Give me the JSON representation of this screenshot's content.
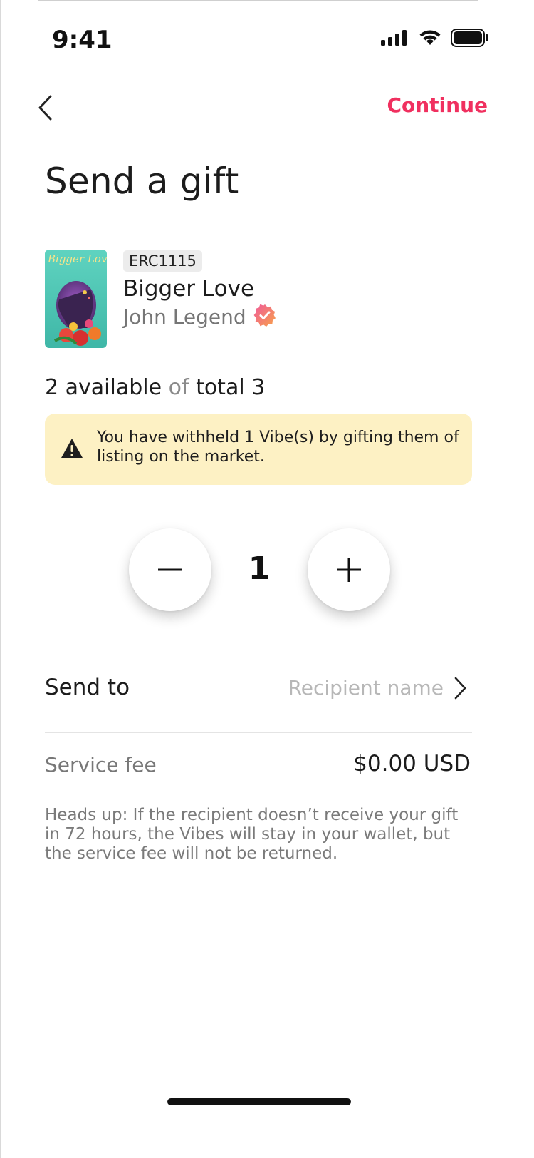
{
  "status_bar": {
    "time": "9:41",
    "icons": [
      "signal-icon",
      "wifi-icon",
      "battery-icon"
    ]
  },
  "nav": {
    "back_icon": "chevron-left-icon",
    "continue_label": "Continue"
  },
  "page": {
    "title": "Send a gift"
  },
  "item": {
    "cover_text": "Bigger Love",
    "token_standard": "ERC1115",
    "title": "Bigger Love",
    "artist": "John Legend",
    "verified_icon": "verified-badge-icon"
  },
  "availability": {
    "available": "2 available",
    "of": "of",
    "total": "total 3"
  },
  "warning": {
    "icon": "warning-triangle-icon",
    "text": "You have withheld 1 Vibe(s) by gifting them of listing on the market."
  },
  "stepper": {
    "decrement_icon": "minus-icon",
    "quantity": "1",
    "increment_icon": "plus-icon"
  },
  "send_to": {
    "label": "Send to",
    "placeholder": "Recipient name",
    "chevron_icon": "chevron-right-icon"
  },
  "fee": {
    "label": "Service fee",
    "value": "$0.00 USD"
  },
  "note": "Heads up:  If the recipient doesn’t receive your gift in 72 hours, the Vibes will stay in your wallet, but the service fee will not be returned.",
  "colors": {
    "accent": "#f0305f",
    "warning_bg": "#fdf1c4",
    "verified_gradient_start": "#f05a9a",
    "verified_gradient_end": "#f7a24a"
  }
}
